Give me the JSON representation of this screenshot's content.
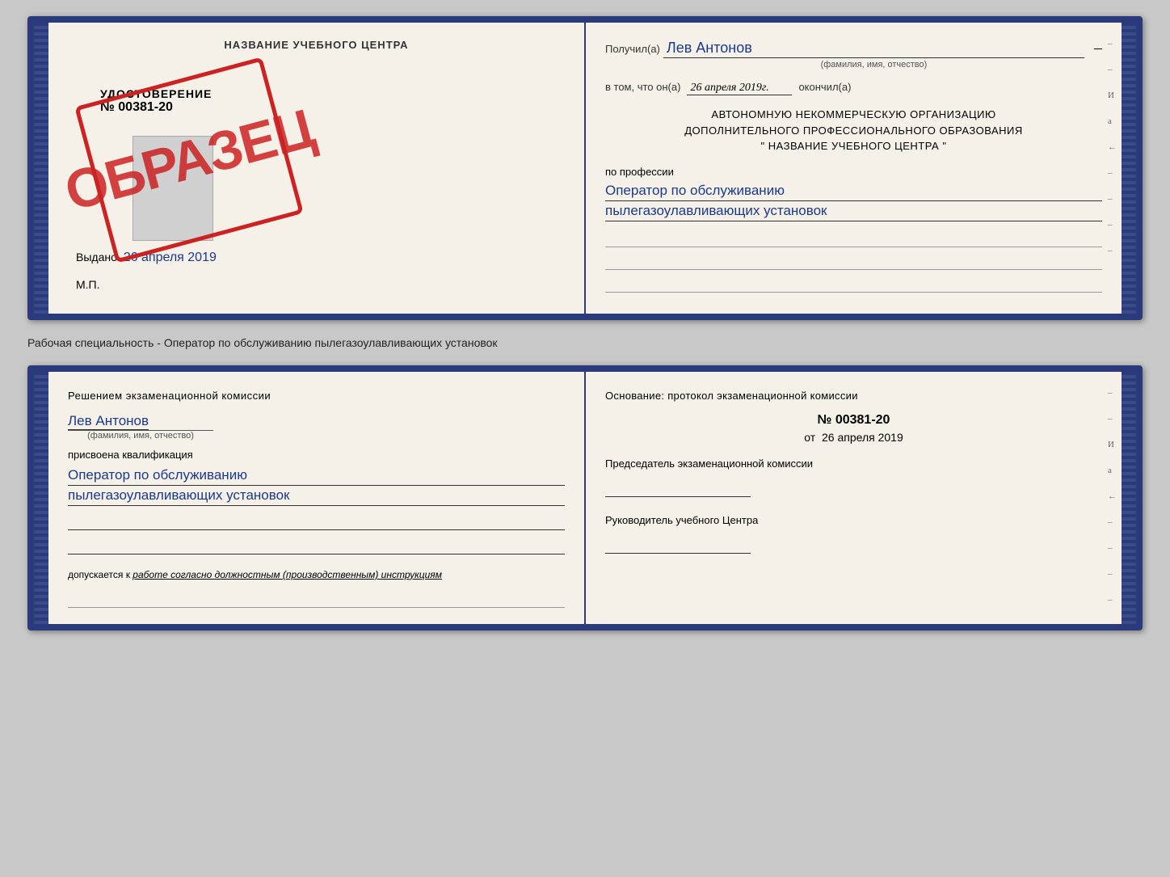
{
  "page": {
    "background_color": "#c8c8c8"
  },
  "book1": {
    "left": {
      "title": "НАЗВАНИЕ УЧЕБНОГО ЦЕНТРА",
      "udostoverenie_label": "УДОСТОВЕРЕНИЕ",
      "number": "№ 00381-20",
      "issued_label": "Выдано",
      "issued_date": "26 апреля 2019",
      "mp_label": "М.П.",
      "stamp_text": "ОБРАЗЕЦ"
    },
    "right": {
      "recipient_prefix": "Получил(а)",
      "recipient_name": "Лев Антонов",
      "recipient_subtext": "(фамилия, имя, отчество)",
      "date_prefix": "в том, что он(а)",
      "date_value": "26 апреля 2019г.",
      "date_suffix": "окончил(а)",
      "org_line1": "АВТОНОМНУЮ НЕКОММЕРЧЕСКУЮ ОРГАНИЗАЦИЮ",
      "org_line2": "ДОПОЛНИТЕЛЬНОГО ПРОФЕССИОНАЛЬНОГО ОБРАЗОВАНИЯ",
      "org_line3": "\"  НАЗВАНИЕ УЧЕБНОГО ЦЕНТРА  \"",
      "profession_label": "по профессии",
      "profession_line1": "Оператор по обслуживанию",
      "profession_line2": "пылегазоулавливающих установок"
    }
  },
  "specialty_label": "Рабочая специальность - Оператор по обслуживанию пылегазоулавливающих установок",
  "book2": {
    "left": {
      "decision_text": "Решением экзаменационной комиссии",
      "name": "Лев Антонов",
      "name_subtext": "(фамилия, имя, отчество)",
      "qualification_label": "присвоена квалификация",
      "qualification_line1": "Оператор по обслуживанию",
      "qualification_line2": "пылегазоулавливающих установок",
      "допускается_prefix": "допускается к",
      "допускается_value": "работе согласно должностным (производственным) инструкциям"
    },
    "right": {
      "basis_text": "Основание: протокол экзаменационной комиссии",
      "protocol_number": "№ 00381-20",
      "protocol_date_prefix": "от",
      "protocol_date": "26 апреля 2019",
      "chairman_label": "Председатель экзаменационной комиссии",
      "director_label": "Руководитель учебного Центра"
    }
  },
  "sidebar_marks": {
    "items": [
      "И",
      "а",
      "←",
      "–",
      "–",
      "–",
      "–",
      "–"
    ]
  }
}
